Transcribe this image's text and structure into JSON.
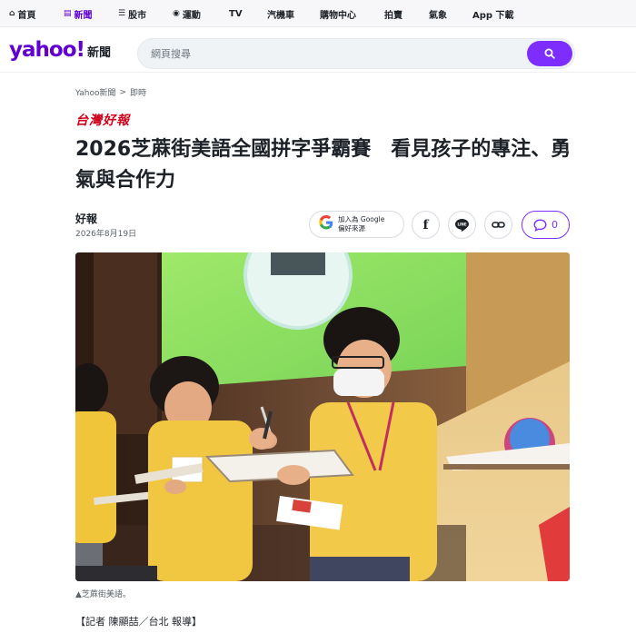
{
  "topnav": {
    "items": [
      {
        "label": "首頁",
        "icon": "home-icon",
        "glyph": "⌂"
      },
      {
        "label": "新聞",
        "icon": "news-icon",
        "glyph": "▤"
      },
      {
        "label": "股市",
        "icon": "stock-icon",
        "glyph": "☰"
      },
      {
        "label": "運動",
        "icon": "sports-icon",
        "glyph": "◉"
      },
      {
        "label": "TV",
        "icon": "",
        "glyph": ""
      },
      {
        "label": "汽機車",
        "icon": "",
        "glyph": ""
      },
      {
        "label": "購物中心",
        "icon": "",
        "glyph": ""
      },
      {
        "label": "拍賣",
        "icon": "",
        "glyph": ""
      },
      {
        "label": "氣象",
        "icon": "",
        "glyph": ""
      },
      {
        "label": "App 下載",
        "icon": "",
        "glyph": ""
      }
    ],
    "active_index": 1
  },
  "header": {
    "logo": "yahoo!",
    "logo_suffix": "新聞",
    "search_placeholder": "網頁搜尋"
  },
  "breadcrumb": {
    "items": [
      "Yahoo新聞",
      "即時"
    ],
    "separator": ">"
  },
  "article": {
    "publisher": "台灣好報",
    "title": "2026芝蔴街美語全國拼字爭霸賽　看見孩子的專注、勇氣與合作力",
    "author": "好報",
    "date": "2026年8月19日",
    "google_source_line1": "加入為 Google",
    "google_source_line2": "偏好來源",
    "comment_count": "0",
    "image_caption": "▲芝蔴街美語。",
    "byline": "【記者 陳顯喆／台北 報導】"
  },
  "colors": {
    "brand": "#6001d2",
    "search_button": "#7d2eff",
    "publisher_red": "#d0021b"
  }
}
